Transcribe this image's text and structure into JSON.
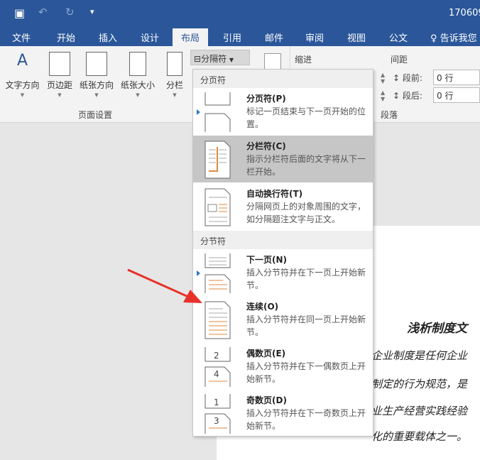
{
  "titlebar": {
    "doc_name": "170609"
  },
  "tabs": [
    {
      "label": "文件"
    },
    {
      "label": "开始"
    },
    {
      "label": "插入"
    },
    {
      "label": "设计"
    },
    {
      "label": "布局"
    },
    {
      "label": "引用"
    },
    {
      "label": "邮件"
    },
    {
      "label": "审阅"
    },
    {
      "label": "视图"
    },
    {
      "label": "公文"
    }
  ],
  "tell_me": "告诉我您",
  "ribbon": {
    "buttons": [
      {
        "label": "文字方向"
      },
      {
        "label": "页边距"
      },
      {
        "label": "纸张方向"
      },
      {
        "label": "纸张大小"
      },
      {
        "label": "分栏"
      }
    ],
    "breaks_label": "分隔符",
    "page_setup_group": "页面设置",
    "indent_label": "缩进",
    "spacing_label": "间距",
    "before_label": "段前:",
    "before_value": "0 行",
    "after_label": "段后:",
    "after_value": "0 行",
    "paragraph_group": "段落"
  },
  "menu": {
    "page_breaks_header": "分页符",
    "section_breaks_header": "分节符",
    "items": [
      {
        "title": "分页符(P)",
        "desc": "标记一页结束与下一页开始的位置。"
      },
      {
        "title": "分栏符(C)",
        "desc": "指示分栏符后面的文字将从下一栏开始。"
      },
      {
        "title": "自动换行符(T)",
        "desc": "分隔网页上的对象周围的文字，如分隔题注文字与正文。"
      },
      {
        "title": "下一页(N)",
        "desc": "插入分节符并在下一页上开始新节。"
      },
      {
        "title": "连续(O)",
        "desc": "插入分节符并在同一页上开始新节。"
      },
      {
        "title": "偶数页(E)",
        "desc": "插入分节符并在下一偶数页上开始新节。"
      },
      {
        "title": "奇数页(D)",
        "desc": "插入分节符并在下一奇数页上开始新节。"
      }
    ]
  },
  "document": {
    "title": "浅析制度文",
    "lines": [
      "企业制度是任何企业",
      "制定的行为规范，是",
      "业生产经营实践经验",
      "化的重要载体之一。"
    ]
  },
  "colors": {
    "brand": "#2b579a",
    "highlight": "#c6c6c6",
    "arrow": "#e8312a"
  }
}
